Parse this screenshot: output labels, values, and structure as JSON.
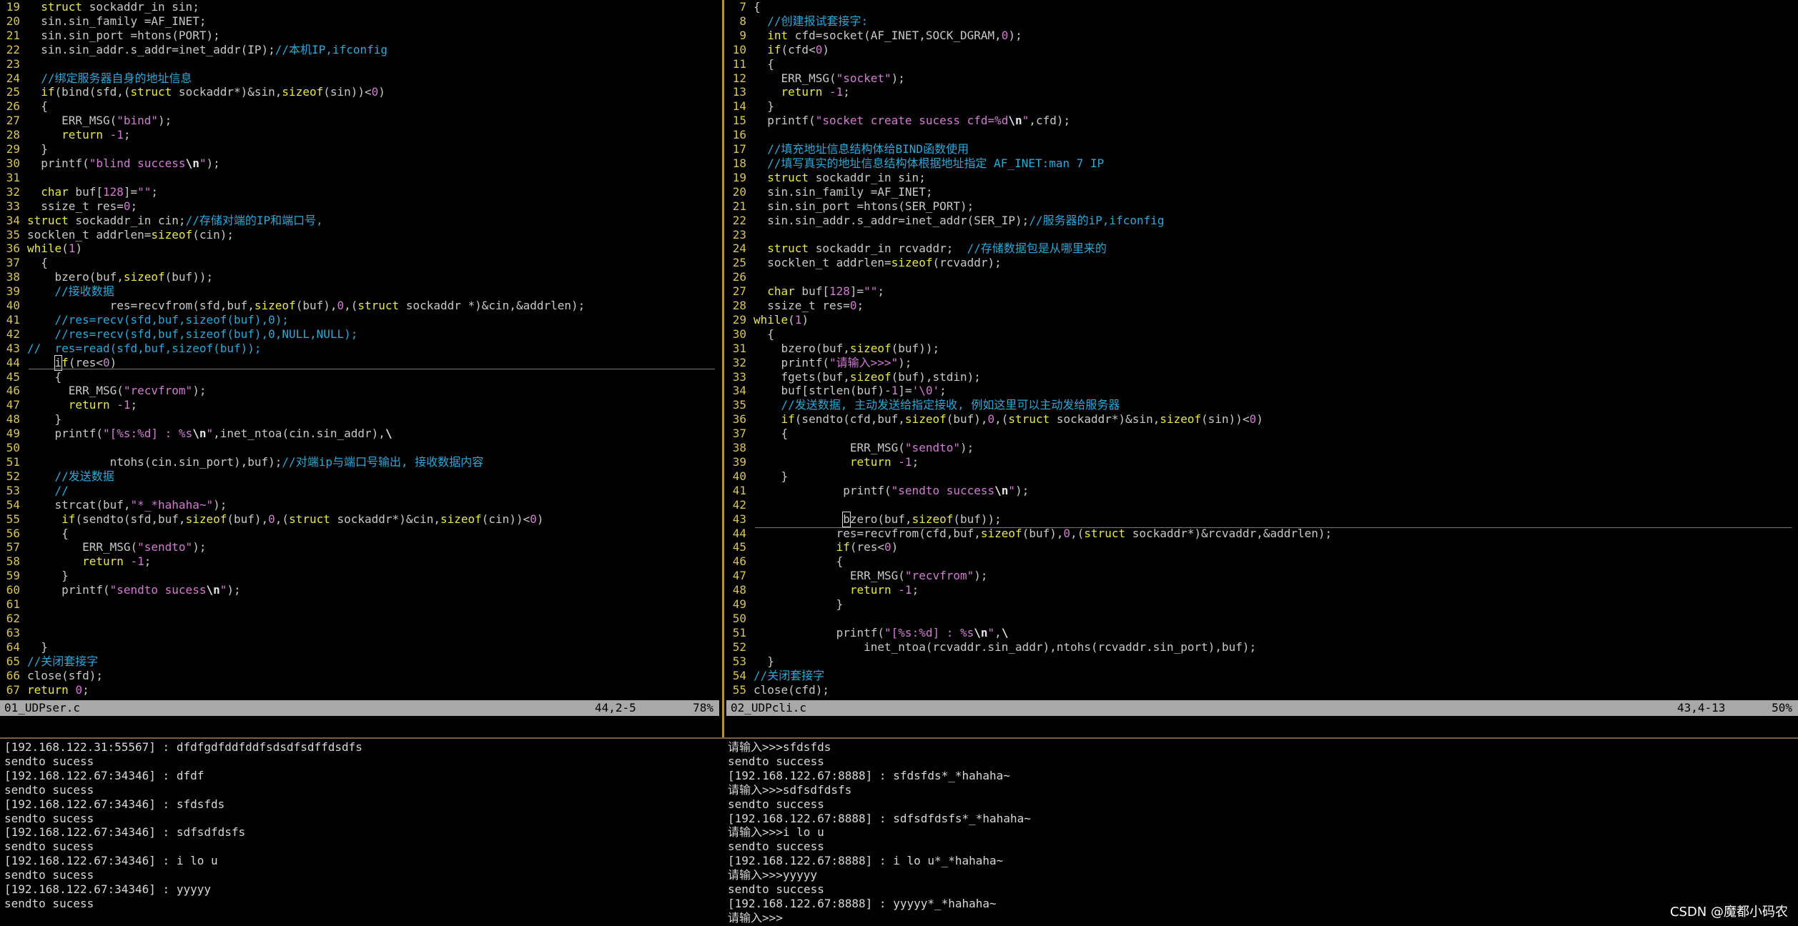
{
  "left_editor": {
    "filename": "01_UDPser.c",
    "position": "44,2-5",
    "percent": "78%",
    "lines": [
      {
        "n": "19",
        "html": "  <span class='kw'>struct</span> sockaddr_in sin;"
      },
      {
        "n": "20",
        "html": "  sin.sin_family =AF_INET;"
      },
      {
        "n": "21",
        "html": "  sin.sin_port =htons(PORT);"
      },
      {
        "n": "22",
        "html": "  sin.sin_addr.s_addr=inet_addr(IP);<span class='cm'>//本机IP,ifconfig</span>"
      },
      {
        "n": "23",
        "html": ""
      },
      {
        "n": "24",
        "html": "  <span class='cm'>//绑定服务器自身的地址信息</span>"
      },
      {
        "n": "25",
        "html": "  <span class='kw'>if</span>(bind(sfd,(<span class='kw'>struct</span> sockaddr*)&amp;sin,<span class='kw'>sizeof</span>(sin))&lt;<span class='num'>0</span>)"
      },
      {
        "n": "26",
        "html": "  {"
      },
      {
        "n": "27",
        "html": "     ERR_MSG(<span class='str'>\"bind\"</span>);"
      },
      {
        "n": "28",
        "html": "     <span class='kw'>return</span> <span class='num'>-1</span>;"
      },
      {
        "n": "29",
        "html": "  }"
      },
      {
        "n": "30",
        "html": "  printf(<span class='str'>\"blind success<span class='esc'>\\n</span>\"</span>);"
      },
      {
        "n": "31",
        "html": ""
      },
      {
        "n": "32",
        "html": "  <span class='kw'>char</span> buf[<span class='num'>128</span>]=<span class='str'>\"\"</span>;"
      },
      {
        "n": "33",
        "html": "  ssize_t res=<span class='num'>0</span>;"
      },
      {
        "n": "34",
        "html": "<span class='kw'>struct</span> sockaddr_in cin;<span class='cm'>//存储对端的IP和端口号,</span>"
      },
      {
        "n": "35",
        "html": "socklen_t addrlen=<span class='kw'>sizeof</span>(cin);"
      },
      {
        "n": "36",
        "html": "<span class='kw'>while</span>(<span class='num'>1</span>)"
      },
      {
        "n": "37",
        "html": "  {"
      },
      {
        "n": "38",
        "html": "    bzero(buf,<span class='kw'>sizeof</span>(buf));"
      },
      {
        "n": "39",
        "html": "    <span class='cm'>//接收数据</span>"
      },
      {
        "n": "40",
        "html": "            res=recvfrom(sfd,buf,<span class='kw'>sizeof</span>(buf),<span class='num'>0</span>,(<span class='kw'>struct</span> sockaddr *)&amp;cin,&amp;addrlen);"
      },
      {
        "n": "41",
        "html": "    <span class='cm'>//res=recv(sfd,buf,sizeof(buf),0);</span>"
      },
      {
        "n": "42",
        "html": "    <span class='cm'>//res=recv(sfd,buf,sizeof(buf),0,NULL,NULL);</span>"
      },
      {
        "n": "43",
        "html": "<span class='cm'>//  res=read(sfd,buf,sizeof(buf));</span>"
      },
      {
        "n": "44",
        "html": "    <span class='cursor'>i</span><span class='kw'>f</span>(res&lt;<span class='num'>0</span>)"
      },
      {
        "n": "45",
        "html": "    {"
      },
      {
        "n": "46",
        "html": "      ERR_MSG(<span class='str'>\"recvfrom\"</span>);"
      },
      {
        "n": "47",
        "html": "      <span class='kw'>return</span> <span class='num'>-1</span>;"
      },
      {
        "n": "48",
        "html": "    }"
      },
      {
        "n": "49",
        "html": "    printf(<span class='str'>\"[%s:%d] : %s<span class='esc'>\\n</span>\"</span>,inet_ntoa(cin.sin_addr),<span class='esc'>\\</span>"
      },
      {
        "n": "50",
        "html": ""
      },
      {
        "n": "51",
        "html": "            ntohs(cin.sin_port),buf);<span class='cm'>//对端ip与端口号输出, 接收数据内容</span>"
      },
      {
        "n": "52",
        "html": "    <span class='cm'>//发送数据</span>"
      },
      {
        "n": "53",
        "html": "    <span class='cm'>//</span>"
      },
      {
        "n": "54",
        "html": "    strcat(buf,<span class='str'>\"*_*hahaha~\"</span>);"
      },
      {
        "n": "55",
        "html": "     <span class='kw'>if</span>(sendto(sfd,buf,<span class='kw'>sizeof</span>(buf),<span class='num'>0</span>,(<span class='kw'>struct</span> sockaddr*)&amp;cin,<span class='kw'>sizeof</span>(cin))&lt;<span class='num'>0</span>)"
      },
      {
        "n": "56",
        "html": "     {"
      },
      {
        "n": "57",
        "html": "        ERR_MSG(<span class='str'>\"sendto\"</span>);"
      },
      {
        "n": "58",
        "html": "        <span class='kw'>return</span> <span class='num'>-1</span>;"
      },
      {
        "n": "59",
        "html": "     }"
      },
      {
        "n": "60",
        "html": "     printf(<span class='str'>\"sendto sucess<span class='esc'>\\n</span>\"</span>);"
      },
      {
        "n": "61",
        "html": ""
      },
      {
        "n": "62",
        "html": ""
      },
      {
        "n": "63",
        "html": ""
      },
      {
        "n": "64",
        "html": "  }"
      },
      {
        "n": "65",
        "html": "<span class='cm'>//关闭套接字</span>"
      },
      {
        "n": "66",
        "html": "close(sfd);"
      },
      {
        "n": "67",
        "html": "<span class='kw'>return</span> <span class='num'>0</span>;"
      }
    ]
  },
  "right_editor": {
    "filename": "02_UDPcli.c",
    "position": "43,4-13",
    "percent": "50%",
    "lines": [
      {
        "n": "7",
        "html": "{"
      },
      {
        "n": "8",
        "html": "  <span class='cm'>//创建报试套接字:</span>"
      },
      {
        "n": "9",
        "html": "  <span class='kw'>int</span> cfd=socket(AF_INET,SOCK_DGRAM,<span class='num'>0</span>);"
      },
      {
        "n": "10",
        "html": "  <span class='kw'>if</span>(cfd&lt;<span class='num'>0</span>)"
      },
      {
        "n": "11",
        "html": "  {"
      },
      {
        "n": "12",
        "html": "    ERR_MSG(<span class='str'>\"socket\"</span>);"
      },
      {
        "n": "13",
        "html": "    <span class='kw'>return</span> <span class='num'>-1</span>;"
      },
      {
        "n": "14",
        "html": "  }"
      },
      {
        "n": "15",
        "html": "  printf(<span class='str'>\"socket create sucess cfd=%d<span class='esc'>\\n</span>\"</span>,cfd);"
      },
      {
        "n": "16",
        "html": ""
      },
      {
        "n": "17",
        "html": "  <span class='cm'>//填充地址信息结构体给BIND函数使用</span>"
      },
      {
        "n": "18",
        "html": "  <span class='cm'>//填写真实的地址信息结构体根据地址指定 AF_INET:man 7 IP</span>"
      },
      {
        "n": "19",
        "html": "  <span class='kw'>struct</span> sockaddr_in sin;"
      },
      {
        "n": "20",
        "html": "  sin.sin_family =AF_INET;"
      },
      {
        "n": "21",
        "html": "  sin.sin_port =htons(SER_PORT);"
      },
      {
        "n": "22",
        "html": "  sin.sin_addr.s_addr=inet_addr(SER_IP);<span class='cm'>//服务器的iP,ifconfig</span>"
      },
      {
        "n": "23",
        "html": ""
      },
      {
        "n": "24",
        "html": "  <span class='kw'>struct</span> sockaddr_in rcvaddr;  <span class='cm'>//存储数据包是从哪里来的</span>"
      },
      {
        "n": "25",
        "html": "  socklen_t addrlen=<span class='kw'>sizeof</span>(rcvaddr);"
      },
      {
        "n": "26",
        "html": ""
      },
      {
        "n": "27",
        "html": "  <span class='kw'>char</span> buf[<span class='num'>128</span>]=<span class='str'>\"\"</span>;"
      },
      {
        "n": "28",
        "html": "  ssize_t res=<span class='num'>0</span>;"
      },
      {
        "n": "29",
        "html": "<span class='kw'>while</span>(<span class='num'>1</span>)"
      },
      {
        "n": "30",
        "html": "  {"
      },
      {
        "n": "31",
        "html": "    bzero(buf,<span class='kw'>sizeof</span>(buf));"
      },
      {
        "n": "32",
        "html": "    printf(<span class='str'>\"请输入&gt;&gt;&gt;\"</span>);"
      },
      {
        "n": "33",
        "html": "    fgets(buf,<span class='kw'>sizeof</span>(buf),stdin);"
      },
      {
        "n": "34",
        "html": "    buf[strlen(buf)-<span class='num'>1</span>]=<span class='str'>'\\0'</span>;"
      },
      {
        "n": "35",
        "html": "    <span class='cm'>//发送数据, 主动发送给指定接收, 例如这里可以主动发给服务器</span>"
      },
      {
        "n": "36",
        "html": "    <span class='kw'>if</span>(sendto(cfd,buf,<span class='kw'>sizeof</span>(buf),<span class='num'>0</span>,(<span class='kw'>struct</span> sockaddr*)&amp;sin,<span class='kw'>sizeof</span>(sin))&lt;<span class='num'>0</span>)"
      },
      {
        "n": "37",
        "html": "    {"
      },
      {
        "n": "38",
        "html": "              ERR_MSG(<span class='str'>\"sendto\"</span>);"
      },
      {
        "n": "39",
        "html": "              <span class='kw'>return</span> <span class='num'>-1</span>;"
      },
      {
        "n": "40",
        "html": "    }"
      },
      {
        "n": "41",
        "html": "             printf(<span class='str'>\"sendto success<span class='esc'>\\n</span>\"</span>);"
      },
      {
        "n": "42",
        "html": ""
      },
      {
        "n": "43",
        "html": "             <span class='cursor'>b</span>zero(buf,<span class='kw'>sizeof</span>(buf));"
      },
      {
        "n": "44",
        "html": "            res=recvfrom(cfd,buf,<span class='kw'>sizeof</span>(buf),<span class='num'>0</span>,(<span class='kw'>struct</span> sockaddr*)&amp;rcvaddr,&amp;addrlen);"
      },
      {
        "n": "45",
        "html": "            <span class='kw'>if</span>(res&lt;<span class='num'>0</span>)"
      },
      {
        "n": "46",
        "html": "            {"
      },
      {
        "n": "47",
        "html": "              ERR_MSG(<span class='str'>\"recvfrom\"</span>);"
      },
      {
        "n": "48",
        "html": "              <span class='kw'>return</span> <span class='num'>-1</span>;"
      },
      {
        "n": "49",
        "html": "            }"
      },
      {
        "n": "50",
        "html": ""
      },
      {
        "n": "51",
        "html": "            printf(<span class='str'>\"[%s:%d] : %s<span class='esc'>\\n</span>\"</span>,<span class='esc'>\\</span>"
      },
      {
        "n": "52",
        "html": "                inet_ntoa(rcvaddr.sin_addr),ntohs(rcvaddr.sin_port),buf);"
      },
      {
        "n": "53",
        "html": "  }"
      },
      {
        "n": "54",
        "html": "<span class='cm'>//关闭套接字</span>"
      },
      {
        "n": "55",
        "html": "close(cfd);"
      }
    ]
  },
  "left_terminal": {
    "lines": [
      "[192.168.122.31:55567] : dfdfgdfddfddfsdsdfsdffdsdfs",
      "sendto sucess",
      "[192.168.122.67:34346] : dfdf",
      "sendto sucess",
      "[192.168.122.67:34346] : sfdsfds",
      "sendto sucess",
      "[192.168.122.67:34346] : sdfsdfdsfs",
      "sendto sucess",
      "[192.168.122.67:34346] : i lo u",
      "sendto sucess",
      "[192.168.122.67:34346] : yyyyy",
      "sendto sucess"
    ]
  },
  "right_terminal": {
    "lines": [
      "请输入>>>sfdsfds",
      "sendto success",
      "[192.168.122.67:8888] : sfdsfds*_*hahaha~",
      "请输入>>>sdfsdfdsfs",
      "sendto success",
      "[192.168.122.67:8888] : sdfsdfdsfs*_*hahaha~",
      "请输入>>>i lo u",
      "sendto success",
      "[192.168.122.67:8888] : i lo u*_*hahaha~",
      "请输入>>>yyyyy",
      "sendto success",
      "[192.168.122.67:8888] : yyyyy*_*hahaha~",
      "请输入>>>"
    ]
  },
  "watermark": "CSDN @魔都小码农"
}
